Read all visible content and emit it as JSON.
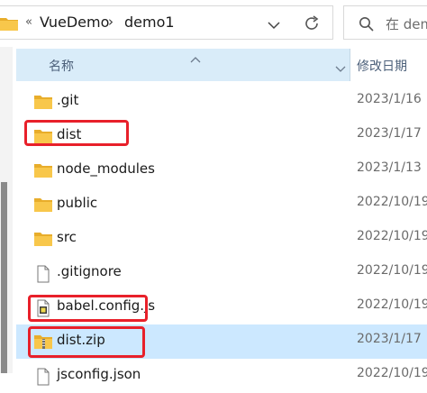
{
  "address_bar": {
    "overflow_chevron": "«",
    "breadcrumb": [
      "VueDemo",
      "demo1"
    ],
    "separator": "›",
    "dropdown_icon": "chevron-down-icon",
    "refresh_icon": "refresh-icon"
  },
  "search": {
    "placeholder": "在 dem",
    "icon": "search-icon"
  },
  "columns": {
    "name": "名称",
    "date_modified": "修改日期"
  },
  "files": [
    {
      "name": ".git",
      "date": "2023/1/16",
      "type": "folder"
    },
    {
      "name": "dist",
      "date": "2023/1/17",
      "type": "folder",
      "highlighted": true
    },
    {
      "name": "node_modules",
      "date": "2023/1/13",
      "type": "folder"
    },
    {
      "name": "public",
      "date": "2022/10/19",
      "type": "folder"
    },
    {
      "name": "src",
      "date": "2022/10/19",
      "type": "folder"
    },
    {
      "name": ".gitignore",
      "date": "2022/10/19",
      "type": "file"
    },
    {
      "name": "babel.config.js",
      "date": "2022/10/19",
      "type": "js-file",
      "highlighted": true
    },
    {
      "name": "dist.zip",
      "date": "2023/1/17",
      "type": "zip",
      "highlighted": true,
      "selected": true
    },
    {
      "name": "jsconfig.json",
      "date": "2022/10/19",
      "type": "file"
    }
  ],
  "colors": {
    "header_bg": "#d9ecf9",
    "selected_row": "#cce8ff",
    "highlight_border": "#e8202a",
    "folder": "#f8c74b"
  }
}
